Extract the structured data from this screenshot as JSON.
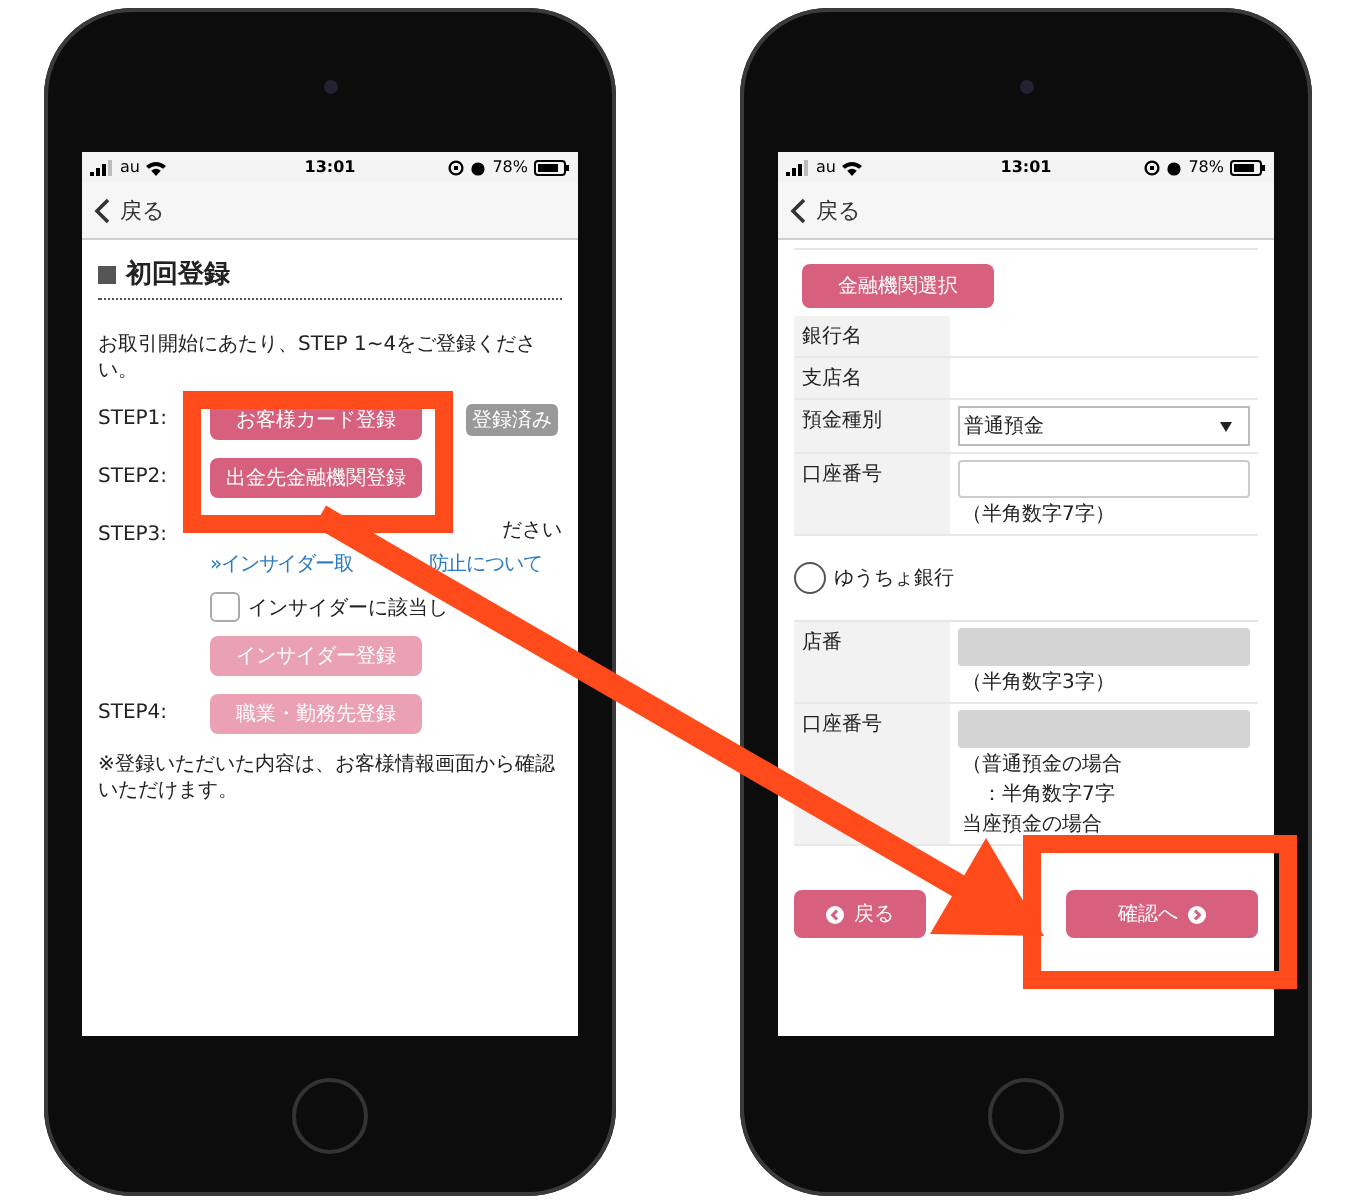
{
  "left": {
    "status_bar": {
      "carrier": "au",
      "time": "13:01",
      "battery": "78%"
    },
    "back": "戻る",
    "title": "初回登録",
    "intro": "お取引開始にあたり、STEP 1~4をご登録ください。",
    "steps": [
      {
        "label": "STEP1:",
        "button": "お客様カード登録",
        "disabled": false,
        "badge": "登録済み"
      },
      {
        "label": "STEP2:",
        "button": "出金先金融機関登録",
        "disabled": false
      },
      {
        "label": "STEP3:",
        "note": "ださい",
        "link_parts": [
          "»インサイダー取",
          "防止について"
        ],
        "checkbox": {
          "label": "インサイダーに該当し",
          "checked": false
        },
        "button": "インサイダー登録",
        "disabled": true
      },
      {
        "label": "STEP4:",
        "button": "職業・勤務先登録",
        "disabled": true
      }
    ],
    "footnote": "※登録いただいた内容は、お客様情報画面から確認いただけます。"
  },
  "right": {
    "status_bar": {
      "carrier": "au",
      "time": "13:01",
      "battery": "78%"
    },
    "back": "戻る",
    "select_button": "金融機関選択",
    "rows": [
      {
        "label": "銀行名",
        "kind": "text"
      },
      {
        "label": "支店名",
        "kind": "text"
      },
      {
        "label": "預金種別",
        "kind": "select",
        "value": "普通預金"
      },
      {
        "label": "口座番号",
        "kind": "input",
        "disabled": false,
        "hints": [
          "（半角数字7字）"
        ]
      }
    ],
    "radio": {
      "label": "ゆうちょ銀行",
      "selected": false
    },
    "yucho_rows": [
      {
        "label": "店番",
        "kind": "input",
        "disabled": true,
        "hints": [
          "（半角数字3字）"
        ]
      },
      {
        "label": "口座番号",
        "kind": "input",
        "disabled": true,
        "hints": [
          "（普通預金の場合",
          "　：半角数字7字",
          "当座預金の場合"
        ]
      }
    ],
    "back_button": "戻る",
    "next_button": "確認へ"
  }
}
